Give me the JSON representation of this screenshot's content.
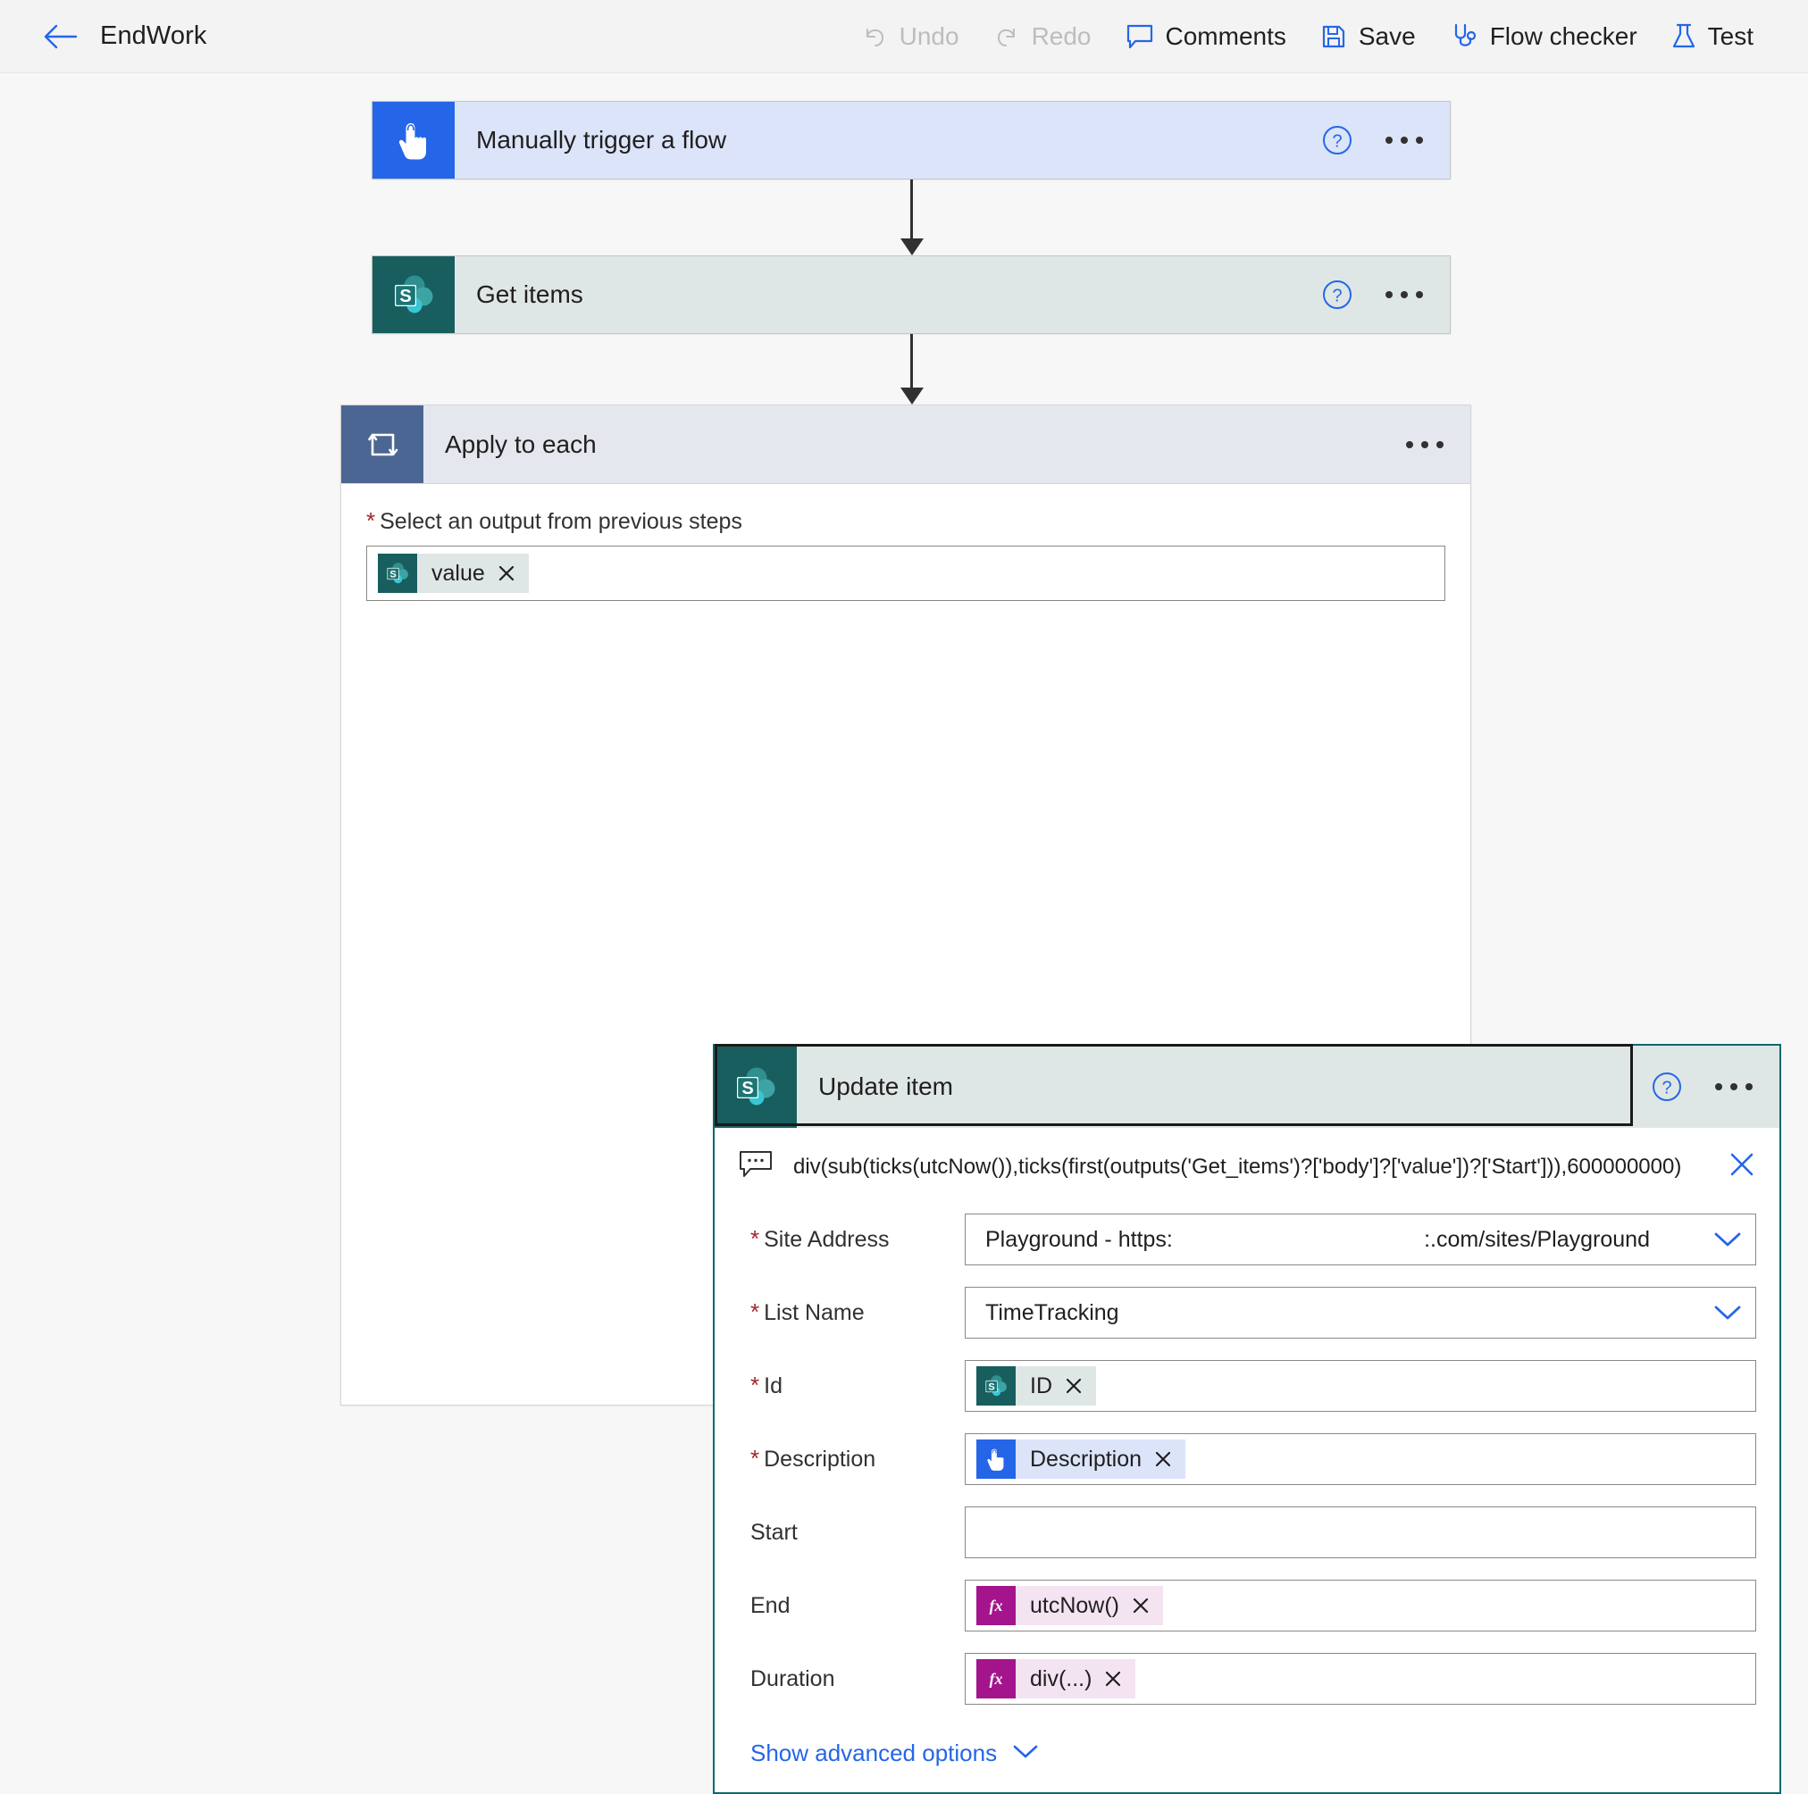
{
  "header": {
    "back_icon": "arrow-left-icon",
    "title": "EndWork",
    "actions": [
      {
        "label": "Undo",
        "icon": "undo-icon",
        "disabled": true
      },
      {
        "label": "Redo",
        "icon": "redo-icon",
        "disabled": true
      },
      {
        "label": "Comments",
        "icon": "comment-icon",
        "disabled": false
      },
      {
        "label": "Save",
        "icon": "save-icon",
        "disabled": false
      },
      {
        "label": "Flow checker",
        "icon": "stethoscope-icon",
        "disabled": false
      },
      {
        "label": "Test",
        "icon": "flask-icon",
        "disabled": false
      }
    ]
  },
  "flow": {
    "trigger": {
      "title": "Manually trigger a flow",
      "icon": "button-trigger-icon",
      "help_icon": "help-circle-icon",
      "menu_icon": "ellipsis-icon"
    },
    "get_items": {
      "title": "Get items",
      "icon": "sharepoint-icon",
      "help_icon": "help-circle-icon",
      "menu_icon": "ellipsis-icon"
    },
    "apply_to_each": {
      "title": "Apply to each",
      "icon": "loop-icon",
      "menu_icon": "ellipsis-icon",
      "select_output_label": "Select an output from previous steps",
      "select_output_required": "*",
      "selected_token": {
        "text": "value",
        "icon": "sharepoint-icon",
        "remove_icon": "close-icon"
      }
    },
    "update_item": {
      "title": "Update item",
      "icon": "sharepoint-icon",
      "help_icon": "help-circle-icon",
      "menu_icon": "ellipsis-icon",
      "expression": {
        "icon": "comment-box-icon",
        "text": "div(sub(ticks(utcNow()),ticks(first(outputs('Get_items')?['body']?['value'])?['Start'])),600000000)",
        "remove_icon": "close-icon"
      },
      "fields": [
        {
          "name": "site-address",
          "label": "Site Address",
          "required": true,
          "type": "combo",
          "value_left": "Playground - https:",
          "value_right": ":.com/sites/Playground",
          "chevron_icon": "chevron-down-icon"
        },
        {
          "name": "list-name",
          "label": "List Name",
          "required": true,
          "type": "combo",
          "value_left": "TimeTracking",
          "value_right": "",
          "chevron_icon": "chevron-down-icon"
        },
        {
          "name": "id",
          "label": "Id",
          "required": true,
          "type": "token",
          "token_kind": "sp",
          "token_text": "ID",
          "token_icon": "sharepoint-icon",
          "remove_icon": "close-icon"
        },
        {
          "name": "description",
          "label": "Description",
          "required": true,
          "type": "token",
          "token_kind": "btn-trigger",
          "token_text": "Description",
          "token_icon": "button-trigger-icon",
          "remove_icon": "close-icon"
        },
        {
          "name": "start",
          "label": "Start",
          "required": false,
          "type": "empty",
          "value": ""
        },
        {
          "name": "end",
          "label": "End",
          "required": false,
          "type": "token",
          "token_kind": "fx",
          "token_text": "utcNow()",
          "token_icon": "function-icon",
          "remove_icon": "close-icon"
        },
        {
          "name": "duration",
          "label": "Duration",
          "required": false,
          "type": "token",
          "token_kind": "fx",
          "token_text": "div(...)",
          "token_icon": "function-icon",
          "remove_icon": "close-icon"
        }
      ],
      "advanced_options_label": "Show advanced options",
      "advanced_options_icon": "chevron-down-icon"
    }
  },
  "colors": {
    "accent_blue": "#2566e8",
    "sharepoint_teal": "#185e5e",
    "loop_slate": "#4c6694",
    "function_magenta": "#a4148c",
    "required_red": "#a4262c",
    "selection_border": "#1b1a19"
  }
}
